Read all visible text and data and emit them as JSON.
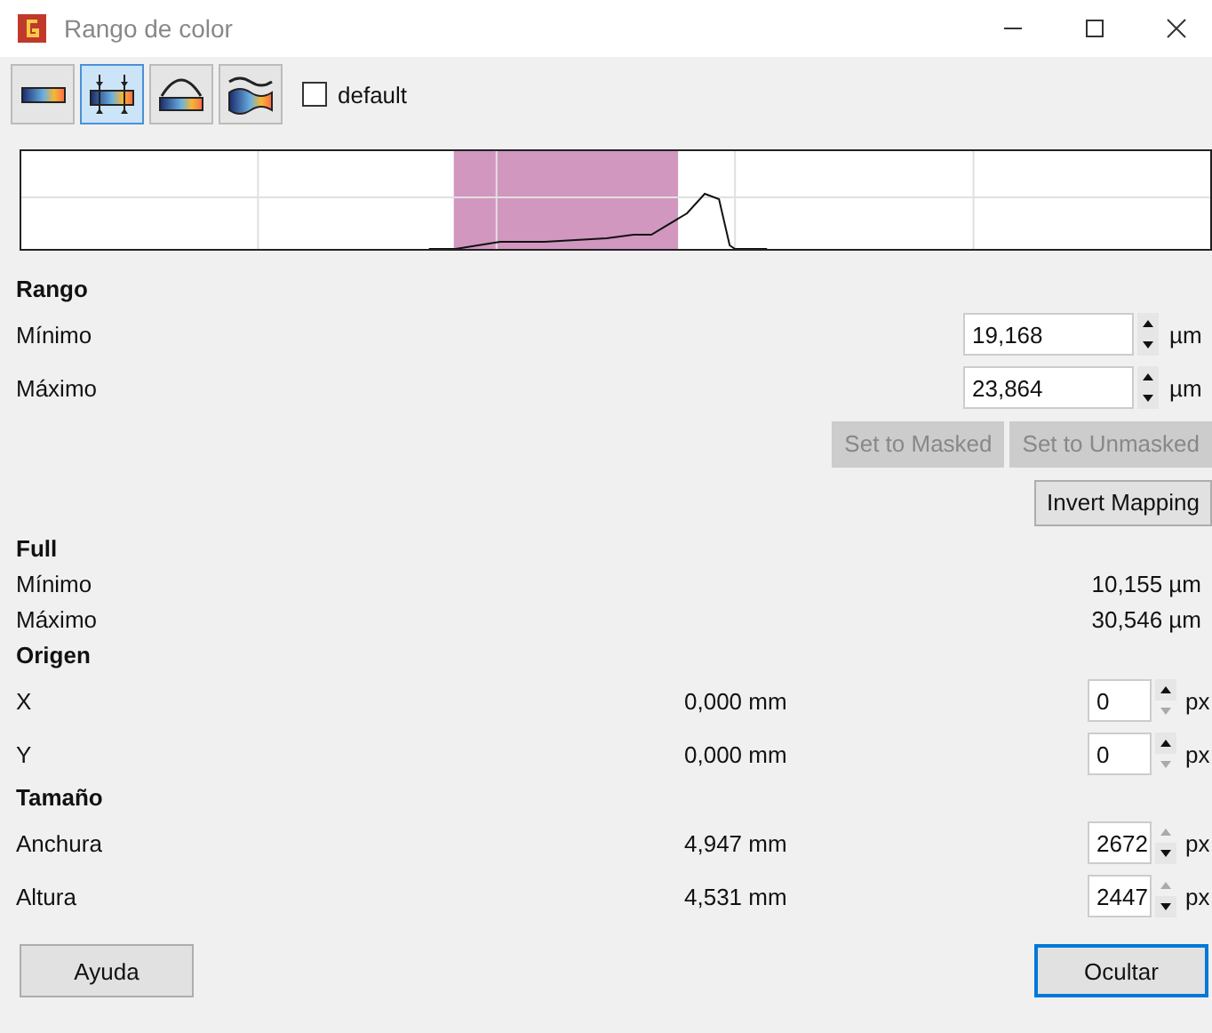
{
  "window": {
    "title": "Rango de color"
  },
  "toolbar": {
    "tools": [
      {
        "kind": "gradient",
        "selected": false
      },
      {
        "kind": "range",
        "selected": true
      },
      {
        "kind": "curve",
        "selected": false
      },
      {
        "kind": "wave",
        "selected": false
      }
    ],
    "default_checkbox": {
      "label": "default",
      "checked": false
    }
  },
  "rango": {
    "heading": "Rango",
    "rows": [
      {
        "label": "Mínimo",
        "value": "19,168",
        "unit": "µm"
      },
      {
        "label": "Máximo",
        "value": "23,864",
        "unit": "µm"
      }
    ],
    "mask_buttons": [
      {
        "label": "Set to Masked",
        "disabled": true
      },
      {
        "label": "Set to Unmasked",
        "disabled": true
      }
    ],
    "invert_button": {
      "label": "Invert Mapping",
      "disabled": false
    }
  },
  "full": {
    "heading": "Full",
    "rows": [
      {
        "label": "Mínimo",
        "value": "10,155 µm"
      },
      {
        "label": "Máximo",
        "value": "30,546 µm"
      }
    ]
  },
  "sections": [
    {
      "heading": "Origen",
      "rows": [
        {
          "label": "X",
          "mm": "0,000 mm",
          "value": "0",
          "unit": "px",
          "up_disabled": false,
          "down_disabled": true
        },
        {
          "label": "Y",
          "mm": "0,000 mm",
          "value": "0",
          "unit": "px",
          "up_disabled": false,
          "down_disabled": true
        }
      ]
    },
    {
      "heading": "Tamaño",
      "rows": [
        {
          "label": "Anchura",
          "mm": "4,947 mm",
          "value": "2672",
          "unit": "px",
          "up_disabled": true,
          "down_disabled": false
        },
        {
          "label": "Altura",
          "mm": "4,531 mm",
          "value": "2447",
          "unit": "px",
          "up_disabled": true,
          "down_disabled": false
        }
      ]
    }
  ],
  "footer": {
    "help_button": "Ayuda",
    "hide_button": "Ocultar"
  }
}
